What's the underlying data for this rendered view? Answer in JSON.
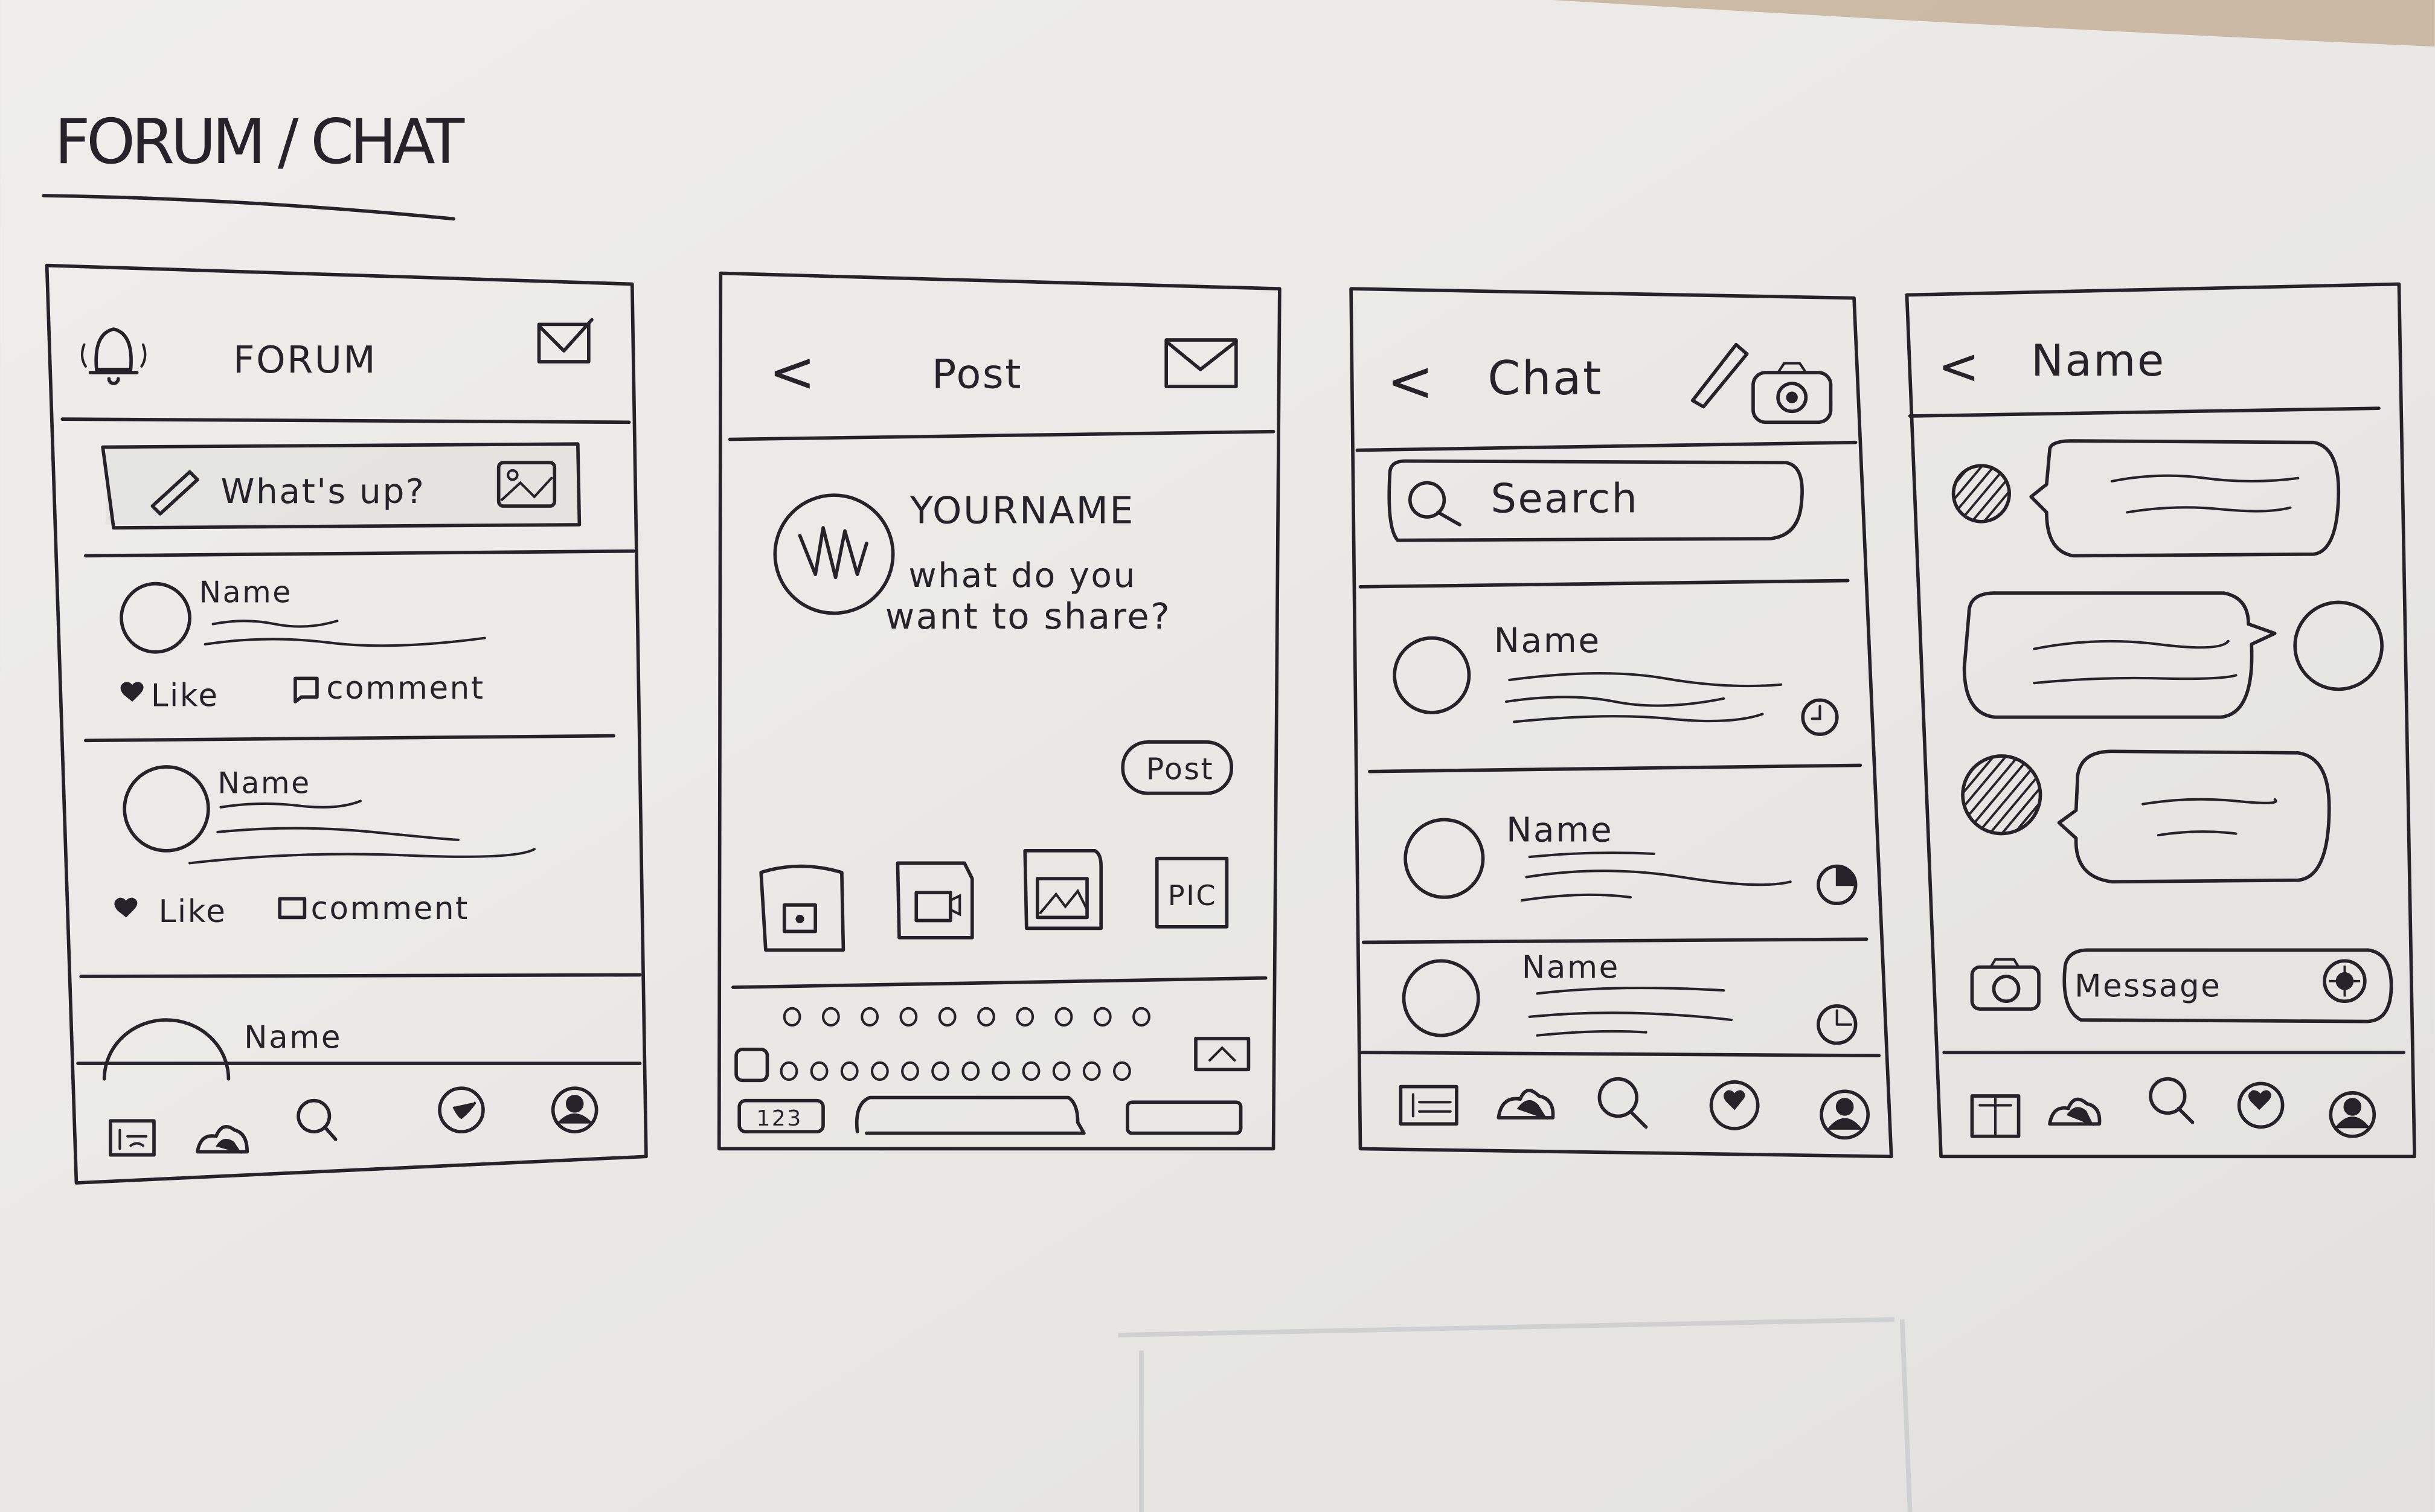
{
  "page_title": "FORUM / CHAT",
  "colors": {
    "paper": "#ecebe8",
    "ink": "#262229"
  },
  "forum_screen": {
    "header_title": "FORUM",
    "header_left_icon": "bell-icon",
    "header_right_icon": "mail-icon",
    "composer_placeholder": "What's up?",
    "posts": [
      {
        "name": "Name",
        "like_label": "Like",
        "comment_label": "comment"
      },
      {
        "name": "Name",
        "like_label": "Like",
        "comment_label": "comment"
      },
      {
        "name": "Name"
      }
    ],
    "nav_icons": [
      "news-icon",
      "community-icon",
      "search-icon",
      "favorites-icon",
      "profile-icon"
    ]
  },
  "post_screen": {
    "header_title": "Post",
    "back_label": "<",
    "your_name": "YOURNAME",
    "prompt_line1": "what do you",
    "prompt_line2": "want to share?",
    "post_button": "Post",
    "attachments": [
      "camera-icon",
      "video-icon",
      "image-icon",
      "PIC"
    ],
    "keyboard_numbers_key": "123"
  },
  "chat_screen": {
    "header_title": "Chat",
    "back_label": "<",
    "search_placeholder": "Search",
    "conversations": [
      {
        "name": "Name"
      },
      {
        "name": "Name"
      },
      {
        "name": "Name"
      }
    ],
    "nav_icons": [
      "news-icon",
      "community-icon",
      "search-icon",
      "favorites-icon",
      "profile-icon"
    ]
  },
  "conversation_screen": {
    "header_title": "Name",
    "back_label": "<",
    "message_placeholder": "Message",
    "nav_icons": [
      "news-icon",
      "community-icon",
      "search-icon",
      "favorites-icon",
      "profile-icon"
    ]
  }
}
